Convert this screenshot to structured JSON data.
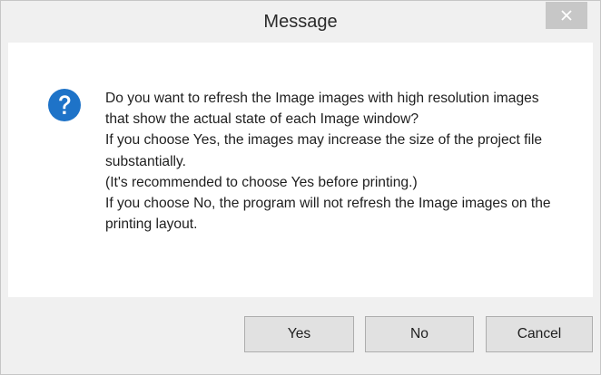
{
  "dialog": {
    "title": "Message",
    "icon": "question-icon",
    "message": "Do you want to refresh the Image images with high resolution images\nthat show the actual state of each Image window?\n If you choose Yes, the images may increase the size of the project file substantially.\n (It's recommended to choose Yes before printing.)\n If you choose No, the program will not refresh the Image images on the printing layout.",
    "buttons": {
      "yes": "Yes",
      "no": "No",
      "cancel": "Cancel"
    }
  },
  "colors": {
    "titlebar": "#f0f0f0",
    "close_button": "#c7c7c7",
    "icon_blue": "#1e73c8",
    "body": "#ffffff"
  }
}
